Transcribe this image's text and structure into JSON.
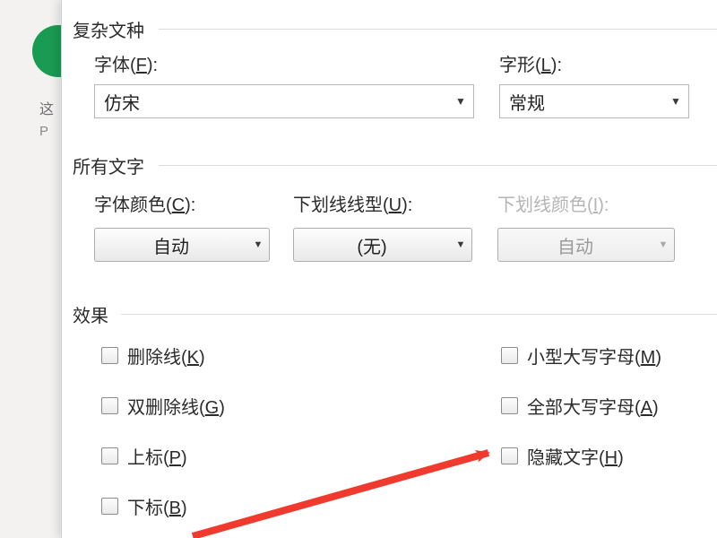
{
  "bg": {
    "line1": "这",
    "line2": "P"
  },
  "sections": {
    "complex_scripts": "复杂文种",
    "all_text": "所有文字",
    "effects": "效果"
  },
  "fields": {
    "font_label_pre": "字体(",
    "font_key": "F",
    "font_label_post": "):",
    "style_label_pre": "字形(",
    "style_key": "L",
    "style_label_post": "):",
    "font_color_pre": "字体颜色(",
    "font_color_key": "C",
    "font_color_post": "):",
    "underline_style_pre": "下划线线型(",
    "underline_style_key": "U",
    "underline_style_post": "):",
    "underline_color_pre": "下划线颜色(",
    "underline_color_key": "I",
    "underline_color_post": "):"
  },
  "values": {
    "font": "仿宋",
    "style": "常规",
    "font_color": "自动",
    "underline_style": "(无)",
    "underline_color": "自动"
  },
  "checks": {
    "strikethrough_pre": "删除线(",
    "strikethrough_key": "K",
    "strikethrough_post": ")",
    "double_strike_pre": "双删除线(",
    "double_strike_key": "G",
    "double_strike_post": ")",
    "superscript_pre": "上标(",
    "superscript_key": "P",
    "superscript_post": ")",
    "subscript_pre": "下标(",
    "subscript_key": "B",
    "subscript_post": ")",
    "small_caps_pre": "小型大写字母(",
    "small_caps_key": "M",
    "small_caps_post": ")",
    "all_caps_pre": "全部大写字母(",
    "all_caps_key": "A",
    "all_caps_post": ")",
    "hidden_pre": "隐藏文字(",
    "hidden_key": "H",
    "hidden_post": ")"
  }
}
